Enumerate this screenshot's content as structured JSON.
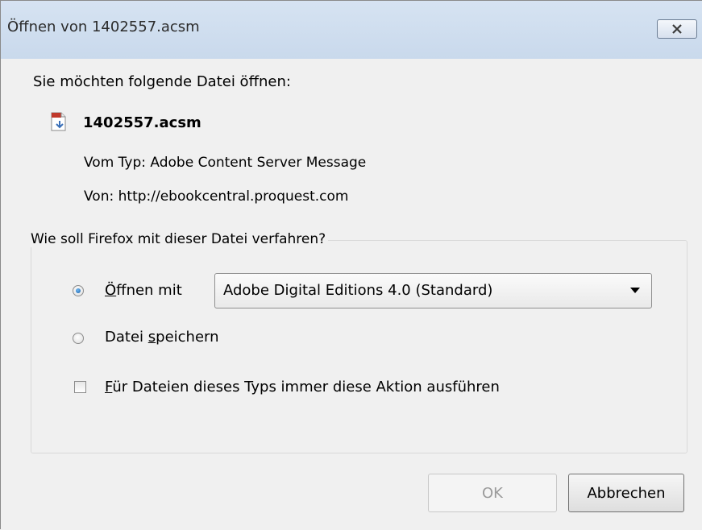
{
  "window": {
    "title": "Öffnen von 1402557.acsm",
    "close_icon": "close-icon"
  },
  "prompt": "Sie möchten folgende Datei öffnen:",
  "file": {
    "icon": "acsm-file-icon",
    "name": "1402557.acsm",
    "type_label": "Vom Typ:",
    "type_value": "Adobe Content Server Message",
    "from_label": "Von:",
    "from_value": "http://ebookcentral.proquest.com"
  },
  "action_group": {
    "legend": "Wie soll Firefox mit dieser Datei verfahren?",
    "open_with": {
      "label_accel": "Ö",
      "label_rest": "ffnen mit",
      "checked": true,
      "selected_app": "Adobe Digital Editions 4.0 (Standard)"
    },
    "save_file": {
      "label_pre": "Datei ",
      "label_accel": "s",
      "label_post": "peichern",
      "checked": false
    },
    "always": {
      "label_accel": "F",
      "label_rest": "ür Dateien dieses Typs immer diese Aktion ausführen",
      "checked": false
    }
  },
  "buttons": {
    "ok": "OK",
    "cancel": "Abbrechen"
  },
  "colors": {
    "titlebar": "#d6e3f2",
    "dialog_bg": "#f0f0f0",
    "radio_selected": "#1c5fa8"
  }
}
